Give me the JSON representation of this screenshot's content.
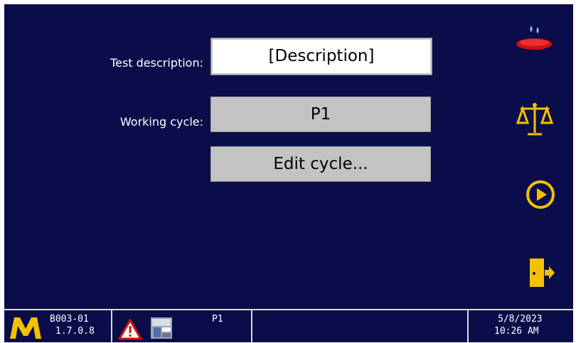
{
  "form": {
    "description_label": "Test description:",
    "description_value": "[Description]",
    "cycle_label": "Working cycle:",
    "cycle_value": "P1",
    "edit_button_label": "Edit cycle..."
  },
  "sidebar": {
    "icons": [
      "wet-dish-icon",
      "balance-scale-icon",
      "play-icon",
      "exit-door-icon"
    ]
  },
  "statusbar": {
    "logo_letter": "M",
    "device_id": "B003-01",
    "version": "1.7.0.8",
    "current_cycle": "P1",
    "date": "5/8/2023",
    "time": "10:26 AM"
  },
  "colors": {
    "background": "#0b0d4a",
    "accent": "#f2c200",
    "alarm": "#d01010"
  }
}
